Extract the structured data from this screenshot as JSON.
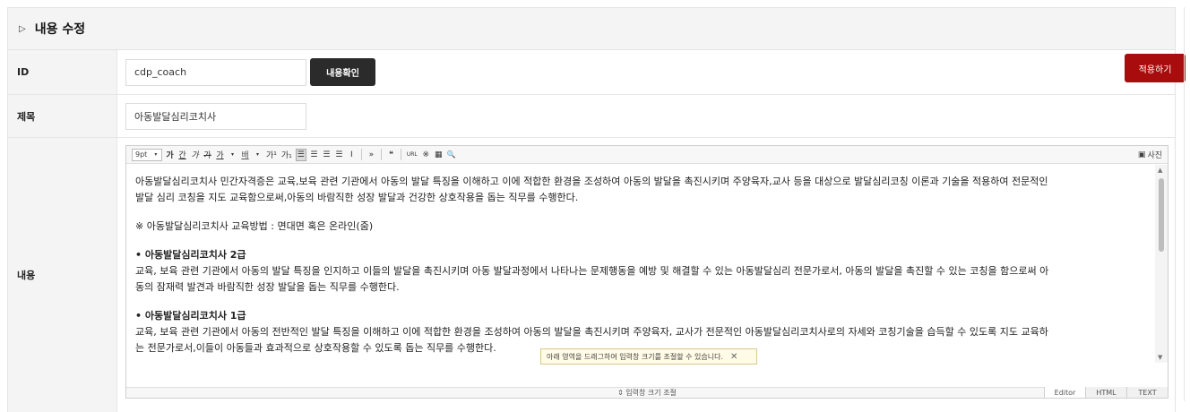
{
  "header": {
    "title": "내용 수정"
  },
  "apply_button": "적용하기",
  "id_row": {
    "label": "ID",
    "value": "cdp_coach",
    "check_button": "내용확인"
  },
  "title_row": {
    "label": "제목",
    "value": "아동발달심리코치사"
  },
  "content_row": {
    "label": "내용"
  },
  "toolbar": {
    "font_size": "9pt",
    "bold": "가",
    "underline": "간",
    "italic": "가",
    "strike": "가",
    "font_color": "가",
    "bg_color": "배",
    "superscript": "가¹",
    "subscript": "가₁",
    "blockquote": "»",
    "quote": "❝",
    "link": "URL",
    "special": "※",
    "table": "▦",
    "search": "🔍",
    "photo": "사진"
  },
  "content": {
    "intro": "아동발달심리코치사 민간자격증은 교육,보육 관련 기관에서 아동의 발달 특징을 이해하고 이에 적합한 환경을 조성하여 아동의 발달을 촉진시키며 주양육자,교사 등을 대상으로 발달심리코칭 이론과 기술을 적용하여 전문적인",
    "intro2": "발달 심리 코칭을 지도 교육함으로써,아동의 바람직한 성장 발달과 건강한 상호작용을 돕는 직무를 수행한다.",
    "method": "※ 아동발달심리코치사 교육방법 : 면대면 혹은 온라인(줌)",
    "grade2_title": "• 아동발달심리코치사 2급",
    "grade2_line1": "교육, 보육 관련 기관에서 아동의 발달 특징을 인지하고 이들의 발달을 촉진시키며 아동 발달과정에서 나타나는 문제행동을 예방 및 해결할 수 있는 아동발달심리 전문가로서, 아동의 발달을 촉진할 수 있는 코칭을 함으로써 아",
    "grade2_line2": "동의 잠재력 발견과 바람직한 성장 발달을 돕는 직무를 수행한다.",
    "grade1_title": "• 아동발달심리코치사 1급",
    "grade1_line1": "교육, 보육 관련 기관에서 아동의 전반적인 발달 특징을 이해하고 이에 적합한 환경을 조성하여 아동의 발달을 촉진시키며 주양육자, 교사가 전문적인 아동발달심리코치사로의 자세와 코칭기술을 습득할 수 있도록 지도 교육하",
    "grade1_line2": "는 전문가로서,이들이 아동들과 효과적으로 상호작용할 수 있도록 돕는 직무를 수행한다."
  },
  "tooltip": "아래 영역을 드래그하여 입력창 크기를 조절할 수 있습니다.",
  "resize_label": "⇕ 입력창 크기 조절",
  "modes": [
    "Editor",
    "HTML",
    "TEXT"
  ]
}
